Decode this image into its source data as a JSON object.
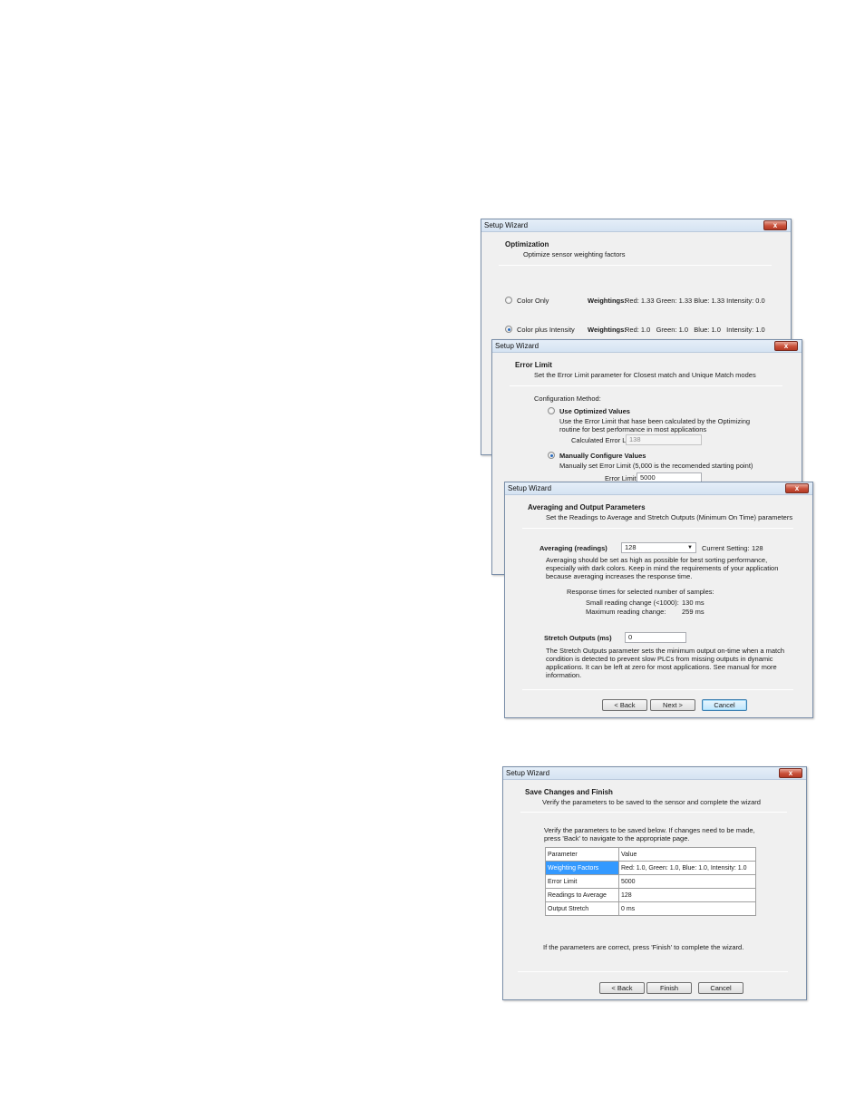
{
  "dialogs": {
    "optimization": {
      "window_title": "Setup Wizard",
      "close_label": "x",
      "title": "Optimization",
      "subtitle": "Optimize sensor weighting factors",
      "options": [
        {
          "label": "Color Only",
          "checked": false,
          "weightings_label": "Weightings:",
          "weightings_value": "Red: 1.33  Green: 1.33  Blue: 1.33  Intensity: 0.0"
        },
        {
          "label": "Color plus Intensity",
          "checked": true,
          "weightings_label": "Weightings:",
          "weightings_value": "Red: 1.0   Green: 1.0   Blue: 1.0   Intensity: 1.0"
        }
      ]
    },
    "error_limit": {
      "window_title": "Setup Wizard",
      "close_label": "x",
      "title": "Error Limit",
      "subtitle": "Set the Error Limit parameter for Closest match and Unique Match modes",
      "config_method_label": "Configuration Method:",
      "optimized": {
        "label": "Use Optimized Values",
        "checked": false,
        "description_line1": "Use the Error Limit that hase been calculated by the Optimizing",
        "description_line2": "routine for best performance in most applications",
        "field_label": "Calculated Error Limit",
        "field_value": "138"
      },
      "manual": {
        "label": "Manually Configure Values",
        "checked": true,
        "description": "Manually set Error Limit (5,000 is the recomended starting point)",
        "field_label": "Error Limit",
        "field_value": "5000"
      }
    },
    "averaging": {
      "window_title": "Setup Wizard",
      "close_label": "x",
      "title": "Averaging and Output Parameters",
      "subtitle": "Set the Readings to Average and Stretch Outputs (Minimum On Time) parameters",
      "averaging_label": "Averaging (readings)",
      "averaging_value": "128",
      "current_setting_label": "Current Setting:",
      "current_setting_value": "128",
      "averaging_help_1": "Averaging should be set as high as possible for best sorting performance,",
      "averaging_help_2": "especially with dark colors. Keep in mind the requirements of your application",
      "averaging_help_3": "because averaging increases the response time.",
      "response_times_label": "Response times for selected number of samples:",
      "small_change_label": "Small reading change (<1000):",
      "small_change_value": "130 ms",
      "max_change_label": "Maximum reading change:",
      "max_change_value": "259 ms",
      "stretch_label": "Stretch Outputs (ms)",
      "stretch_value": "0",
      "stretch_help_1": "The Stretch Outputs parameter sets the minimum output on-time when a match",
      "stretch_help_2": "condition is detected to prevent slow PLCs from missing outputs in dynamic",
      "stretch_help_3": "applications. It can be left at zero for most applications. See manual for more",
      "stretch_help_4": "information.",
      "buttons": {
        "back": "< Back",
        "next": "Next >",
        "cancel": "Cancel"
      }
    },
    "save_finish": {
      "window_title": "Setup Wizard",
      "close_label": "x",
      "title": "Save Changes and Finish",
      "subtitle": "Verify the parameters to be saved to the sensor and complete the wizard",
      "intro_1": "Verify the parameters to be saved below. If changes need to be made,",
      "intro_2": "press 'Back' to navigate to the appropriate page.",
      "table": {
        "headers": [
          "Parameter",
          "Value"
        ],
        "rows": [
          [
            "Weighting Factors",
            "Red: 1.0, Green: 1.0, Blue: 1.0, Intensity: 1.0"
          ],
          [
            "Error Limit",
            "5000"
          ],
          [
            "Readings to Average",
            "128"
          ],
          [
            "Output Stretch",
            "0 ms"
          ]
        ],
        "selected_row": 0
      },
      "footer_text": "If the parameters are correct, press 'Finish' to complete the wizard.",
      "buttons": {
        "back": "< Back",
        "finish": "Finish",
        "cancel": "Cancel"
      }
    }
  }
}
